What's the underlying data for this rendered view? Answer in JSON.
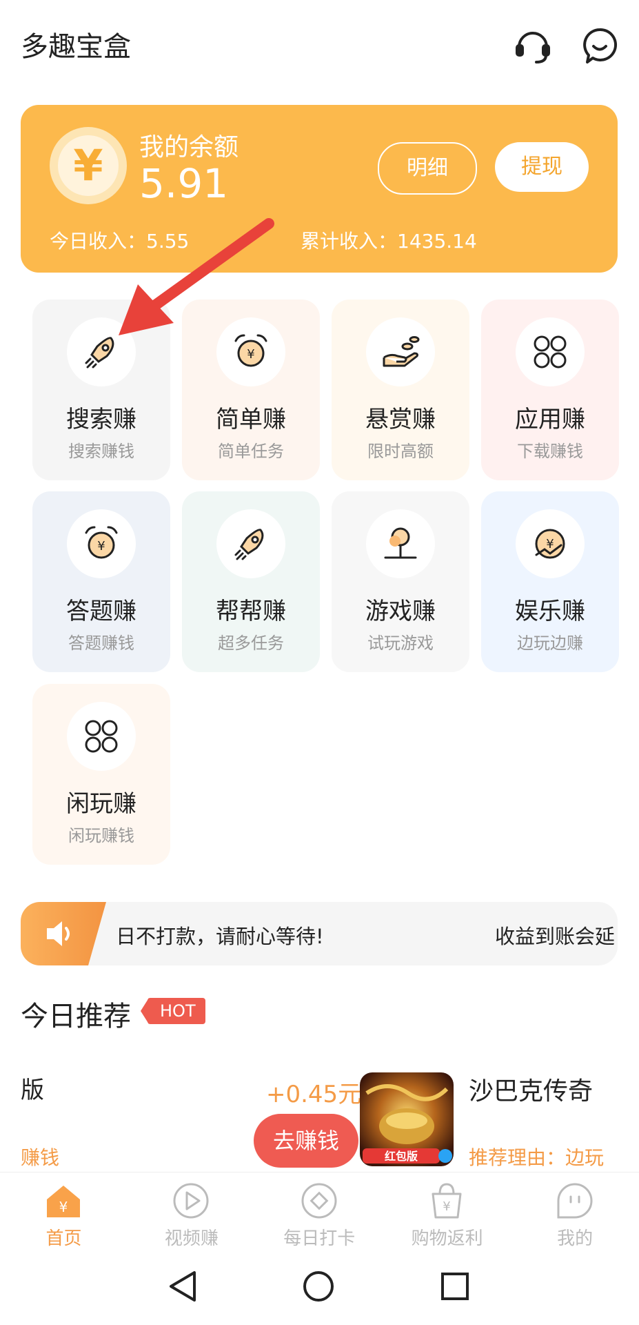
{
  "header": {
    "title": "多趣宝盒",
    "icons": [
      "headset-icon",
      "message-icon"
    ]
  },
  "balance": {
    "label": "我的余额",
    "value": "5.91",
    "currency_symbol": "¥",
    "detail_button": "明细",
    "withdraw_button": "提现",
    "today_income": "今日收入：5.55",
    "total_income": "累计收入：1435.14"
  },
  "tasks": [
    {
      "name": "搜索赚",
      "sub": "搜索赚钱",
      "icon": "rocket-icon",
      "bg": "#f5f5f5"
    },
    {
      "name": "简单赚",
      "sub": "简单任务",
      "icon": "alarm-coin-icon",
      "bg": "#fef5ef"
    },
    {
      "name": "悬赏赚",
      "sub": "限时高额",
      "icon": "hand-coins-icon",
      "bg": "#fff8ee"
    },
    {
      "name": "应用赚",
      "sub": "下载赚钱",
      "icon": "clover-icon",
      "bg": "#fff1f0"
    },
    {
      "name": "答题赚",
      "sub": "答题赚钱",
      "icon": "alarm-coin-icon",
      "bg": "#eef2f8"
    },
    {
      "name": "帮帮赚",
      "sub": "超多任务",
      "icon": "rocket-icon",
      "bg": "#f0f7f5"
    },
    {
      "name": "游戏赚",
      "sub": "试玩游戏",
      "icon": "joystick-icon",
      "bg": "#f7f7f7"
    },
    {
      "name": "娱乐赚",
      "sub": "边玩边赚",
      "icon": "coin-trend-icon",
      "bg": "#eef5ff"
    },
    {
      "name": "闲玩赚",
      "sub": "闲玩赚钱",
      "icon": "clover-icon",
      "bg": "#fff7f0"
    }
  ],
  "notice": {
    "icon": "speaker-icon",
    "text": "日不打款，请耐心等待!",
    "text_tail": "收益到账会延"
  },
  "recommend": {
    "title": "今日推荐",
    "hot_badge": "HOT",
    "left_title": "版",
    "left_sub": "赚钱",
    "price": "+0.45元",
    "go_button": "去赚钱",
    "game_name": "沙巴克传奇",
    "game_badge": "红包版",
    "reason": "推荐理由：边玩"
  },
  "nav": [
    {
      "label": "首页",
      "icon": "home-icon",
      "active": true
    },
    {
      "label": "视频赚",
      "icon": "play-icon",
      "active": false
    },
    {
      "label": "每日打卡",
      "icon": "checkin-icon",
      "active": false
    },
    {
      "label": "购物返利",
      "icon": "shopping-bag-icon",
      "active": false
    },
    {
      "label": "我的",
      "icon": "profile-icon",
      "active": false
    }
  ],
  "colors": {
    "accent": "#fcb94c",
    "orange_text": "#f49b47",
    "red": "#ef5b52",
    "arrow": "#e8423a"
  }
}
